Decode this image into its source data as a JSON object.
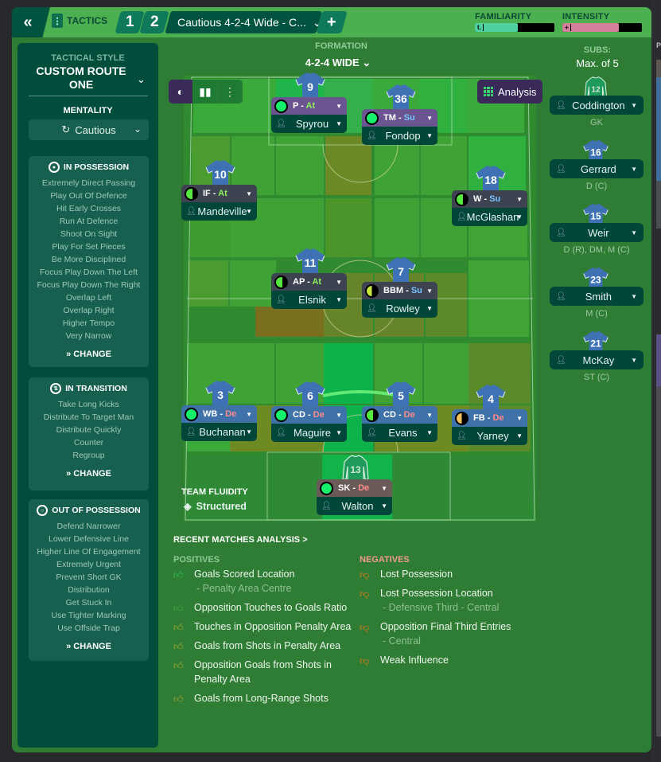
{
  "topbar": {
    "back_icon": "double-chevron-left-icon",
    "back_glyph": "«",
    "tactics_label": "TACTICS",
    "slots": [
      "1",
      "2"
    ],
    "tactic_name": "Cautious 4-2-4 Wide - C...",
    "add_glyph": "+",
    "familiarity": {
      "label": "FAMILIARITY",
      "value_pct": 54,
      "color": "#4fd1a0"
    },
    "intensity": {
      "label": "INTENSITY",
      "value_pct": 71,
      "color": "#d4809c"
    }
  },
  "left_panel": {
    "tactical_style_label": "TACTICAL STYLE",
    "tactical_style_value": "CUSTOM ROUTE ONE",
    "mentality_label": "MENTALITY",
    "mentality_value": "Cautious",
    "in_possession": {
      "title": "IN POSSESSION",
      "items": [
        "Extremely Direct Passing",
        "Play Out Of Defence",
        "Hit Early Crosses",
        "Run At Defence",
        "Shoot On Sight",
        "Play For Set Pieces",
        "Be More Disciplined",
        "Focus Play Down The Left",
        "Focus Play Down The Right",
        "Overlap Left",
        "Overlap Right",
        "Higher Tempo",
        "Very Narrow"
      ],
      "change_label": "CHANGE"
    },
    "in_transition": {
      "title": "IN TRANSITION",
      "items": [
        "Take Long Kicks",
        "Distribute To Target Man",
        "Distribute Quickly",
        "Counter",
        "Regroup"
      ],
      "change_label": "CHANGE"
    },
    "out_of_possession": {
      "title": "OUT OF POSSESSION",
      "items": [
        "Defend Narrower",
        "Lower Defensive Line",
        "Higher Line Of Engagement",
        "Extremely Urgent",
        "Prevent Short GK",
        "Distribution",
        "Get Stuck In",
        "Use Tighter Marking",
        "Use Offside Trap"
      ],
      "change_label": "CHANGE"
    }
  },
  "formation": {
    "label": "FORMATION",
    "value": "4-2-4 WIDE"
  },
  "pitch": {
    "analysis_label": "Analysis",
    "team_fluidity_label": "TEAM FLUIDITY",
    "team_fluidity_value": "Structured",
    "players": [
      {
        "number": "9",
        "role": "P",
        "duty": "At",
        "name": "Spyrou",
        "line": "attack",
        "familiarity": "full"
      },
      {
        "number": "36",
        "role": "TM",
        "duty": "Su",
        "name": "Fondop",
        "line": "attack",
        "familiarity": "full"
      },
      {
        "number": "10",
        "role": "IF",
        "duty": "At",
        "name": "Mandeville",
        "line": "mid",
        "familiarity": "most"
      },
      {
        "number": "18",
        "role": "W",
        "duty": "Su",
        "name": "McGlashan",
        "line": "mid",
        "familiarity": "most"
      },
      {
        "number": "11",
        "role": "AP",
        "duty": "At",
        "name": "Elsnik",
        "line": "mid",
        "familiarity": "most"
      },
      {
        "number": "7",
        "role": "BBM",
        "duty": "Su",
        "name": "Rowley",
        "line": "mid",
        "familiarity": "half"
      },
      {
        "number": "3",
        "role": "WB",
        "duty": "De",
        "name": "Buchanan",
        "line": "def",
        "familiarity": "full"
      },
      {
        "number": "6",
        "role": "CD",
        "duty": "De",
        "name": "Maguire",
        "line": "def",
        "familiarity": "full"
      },
      {
        "number": "5",
        "role": "CD",
        "duty": "De",
        "name": "Evans",
        "line": "def",
        "familiarity": "most"
      },
      {
        "number": "4",
        "role": "FB",
        "duty": "De",
        "name": "Yarney",
        "line": "def",
        "familiarity": "low"
      },
      {
        "number": "13",
        "role": "SK",
        "duty": "De",
        "name": "Walton",
        "line": "gk",
        "familiarity": "full"
      }
    ]
  },
  "subs": {
    "label": "SUBS:",
    "max": "Max. of 5",
    "players": [
      {
        "number": "12",
        "name": "Coddington",
        "position": "GK",
        "gk": true
      },
      {
        "number": "16",
        "name": "Gerrard",
        "position": "D (C)",
        "gk": false
      },
      {
        "number": "15",
        "name": "Weir",
        "position": "D (R), DM, M (C)",
        "gk": false
      },
      {
        "number": "23",
        "name": "Smith",
        "position": "M (C)",
        "gk": false
      },
      {
        "number": "21",
        "name": "McKay",
        "position": "ST (C)",
        "gk": false
      }
    ]
  },
  "analysis": {
    "title": "RECENT MATCHES ANALYSIS >",
    "positives_label": "POSITIVES",
    "negatives_label": "NEGATIVES",
    "positives": [
      {
        "text": "Goals Scored Location",
        "sub": "- Penalty Area Centre",
        "strength": "strong"
      },
      {
        "text": "Opposition Touches to Goals Ratio",
        "sub": "",
        "strength": "medium"
      },
      {
        "text": "Touches in Opposition Penalty Area",
        "sub": "",
        "strength": "weak"
      },
      {
        "text": "Goals from Shots in Penalty Area",
        "sub": "",
        "strength": "weak"
      },
      {
        "text": "Opposition Goals from Shots in Penalty Area",
        "sub": "",
        "strength": "weak"
      },
      {
        "text": "Goals from Long-Range Shots",
        "sub": "",
        "strength": "weak"
      }
    ],
    "negatives": [
      {
        "text": "Lost Possession",
        "sub": ""
      },
      {
        "text": "Lost Possession Location",
        "sub": "- Defensive Third - Central"
      },
      {
        "text": "Opposition Final Third Entries",
        "sub": "- Central"
      },
      {
        "text": "Weak Influence",
        "sub": ""
      }
    ]
  },
  "colors": {
    "app_bg": "#2f7d34",
    "topbar": "#4caf50",
    "panel": "#004d3c",
    "thumb_strong": "#27c75a",
    "thumb_medium": "#3fae4f",
    "thumb_weak": "#a9a632",
    "thumb_negative": "#f07a1a"
  }
}
